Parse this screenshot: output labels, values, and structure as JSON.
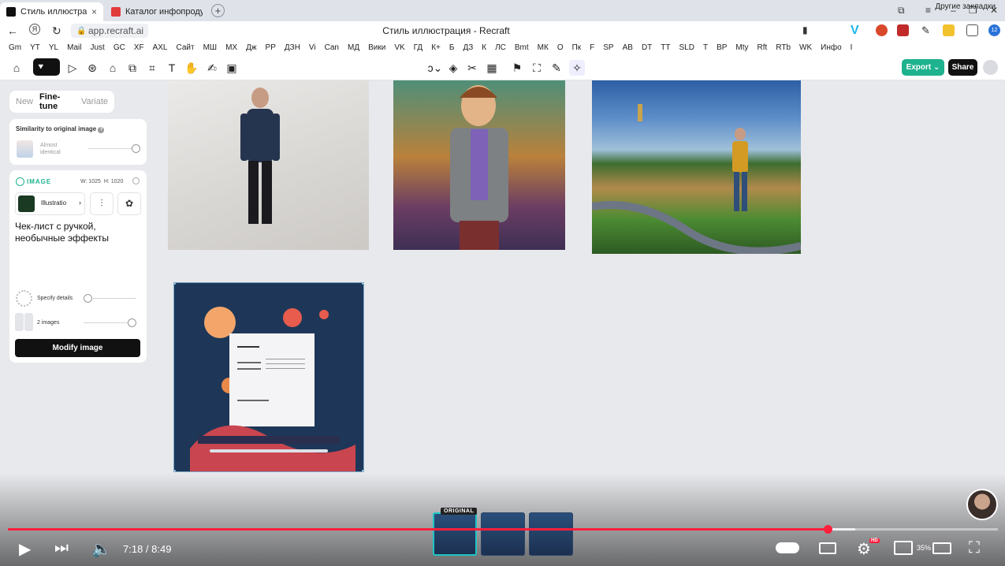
{
  "browser": {
    "tabs": [
      {
        "label": "Стиль иллюстрация - R",
        "close": "×",
        "favicon_color": "#111111"
      },
      {
        "label": "Каталог инфопродуктов",
        "favicon_color": "#e23b3b"
      }
    ],
    "new_tab": "+",
    "url": "app.recraft.ai",
    "page_title": "Стиль иллюстрация - Recraft",
    "extensions_badge": "12",
    "bookmarks": [
      "Gm",
      "YT",
      "YL",
      "Mail",
      "Just",
      "GC",
      "XF",
      "AXL",
      "Сайт",
      "МШ",
      "МХ",
      "Дж",
      "РР",
      "ДЗН",
      "Vi",
      "Can",
      "МД",
      "Вики",
      "VK",
      "ГД",
      "К+",
      "Б",
      "ДЗ",
      "К",
      "ЛС",
      "Bmt",
      "МК",
      "О",
      "Пк",
      "F",
      "SP",
      "AB",
      "DT",
      "TT",
      "SLD",
      "Т",
      "ВР",
      "Mty",
      "Rft",
      "RTb",
      "WK",
      "Инфо",
      "I"
    ],
    "bookmarks_other": "Другие закладки"
  },
  "toolbar": {
    "export_label": "Export",
    "share_label": "Share",
    "accent_color": "#1eb28e"
  },
  "panel": {
    "tabs": [
      {
        "label": "New",
        "active": false
      },
      {
        "label": "Fine-tune",
        "active": true
      },
      {
        "label": "Variate",
        "active": false
      }
    ],
    "similarity_title": "Similarity to original image",
    "similarity_value": "Almost identical",
    "image_section_label": "IMAGE",
    "image_width": "W: 1025",
    "image_height": "H: 1020",
    "style_name": "Illustratio",
    "prompt": "Чек-лист с ручкой, необычные эффекты",
    "specify_details_label": "Specify details",
    "images_count_label": "2 images",
    "modify_button": "Modify image"
  },
  "video": {
    "time_current": "7:18",
    "time_total": "8:49",
    "timecode": "7:18 / 8:49",
    "progress": 0.828,
    "buffered": 0.856,
    "storyboard_badge": "ORIGINAL",
    "hd_badge": "HD",
    "zoom": "35%",
    "progress_color": "#ff1f3d"
  }
}
